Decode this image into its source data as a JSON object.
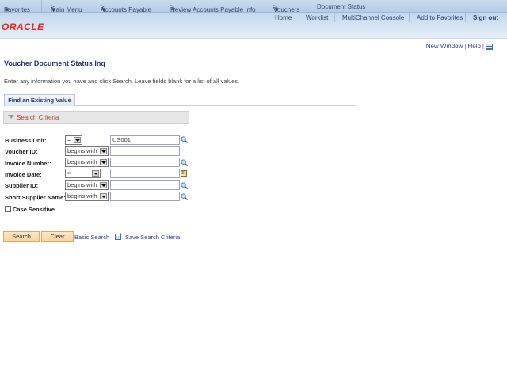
{
  "menubar": {
    "favorites": "Favorites",
    "breadcrumbs": [
      "Main Menu",
      "Accounts Payable",
      "Review Accounts Payable Info",
      "Vouchers",
      "Document Status"
    ]
  },
  "header": {
    "logo": "ORACLE",
    "links": [
      "Home",
      "Worklist",
      "MultiChannel Console",
      "Add to Favorites",
      "Sign out"
    ]
  },
  "utility": {
    "new_window": "New Window",
    "help": "Help",
    "icon": "customize-page-icon"
  },
  "page": {
    "title": "Voucher Document Status Inq",
    "instructions": "Enter any information you have and click Search. Leave fields blank for a list of all values.",
    "tab": "Find an Existing Value",
    "section": "Search Criteria"
  },
  "fields": [
    {
      "label": "Business Unit:",
      "operator": "=",
      "value": "US001",
      "icon": "lookup-icon"
    },
    {
      "label": "Voucher ID:",
      "operator": "begins with",
      "value": ""
    },
    {
      "label": "Invoice Number:",
      "operator": "begins with",
      "value": "",
      "icon": "lookup-icon"
    },
    {
      "label": "Invoice Date:",
      "operator": "=",
      "value": "",
      "icon": "calendar-icon"
    },
    {
      "label": "Supplier ID:",
      "operator": "begins with",
      "value": "",
      "icon": "lookup-icon"
    },
    {
      "label": "Short Supplier Name:",
      "operator": "begins with",
      "value": "",
      "icon": "lookup-icon"
    }
  ],
  "case_sensitive": {
    "label": "Case Sensitive",
    "checked": false
  },
  "actions": {
    "search": "Search",
    "clear": "Clear",
    "basic_search": "Basic Search",
    "save_criteria": "Save Search Criteria"
  }
}
